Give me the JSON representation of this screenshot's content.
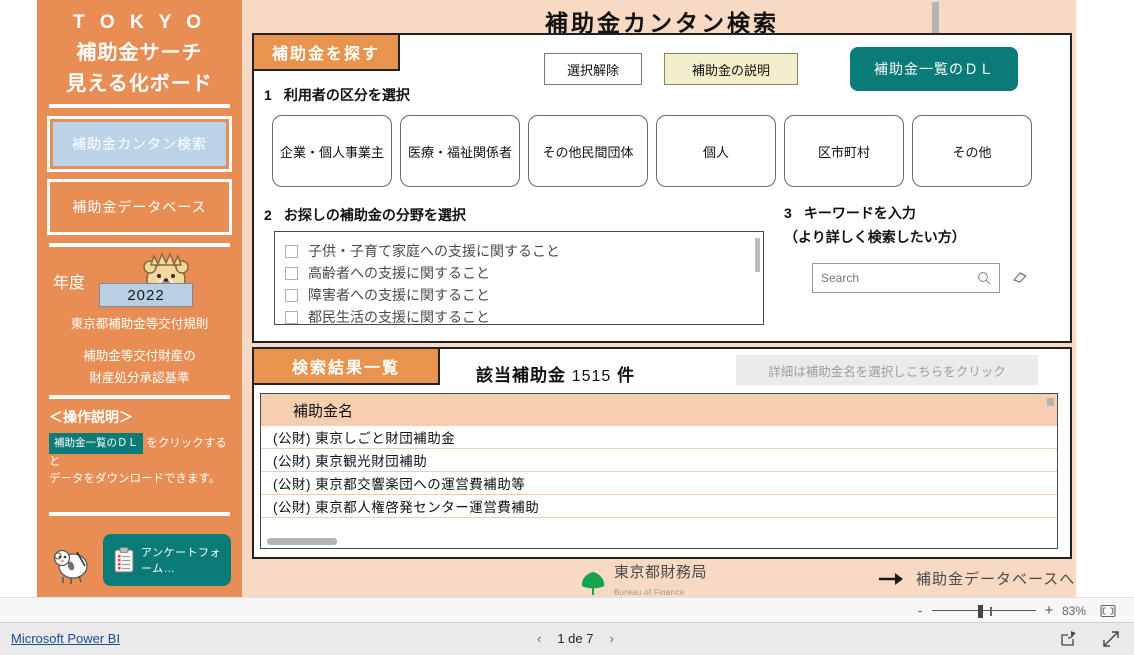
{
  "sidebar": {
    "brand_line1": "T O K Y O",
    "brand_line2": "補助金サーチ",
    "brand_line3": "見える化ボード",
    "nav": [
      {
        "label": "補助金カンタン検索",
        "state": "active"
      },
      {
        "label": "補助金データベース",
        "state": "inactive"
      }
    ],
    "year_label": "年度",
    "year_value": "2022",
    "links": [
      "東京都補助金等交付規則",
      "補助金等交付財産の",
      "財産処分承認基準"
    ],
    "ops_title": "＜操作説明＞",
    "ops_chip": "補助金一覧のＤＬ",
    "ops_text_1": "をクリックすると",
    "ops_text_2": "データをダウンロードできます。",
    "survey_button": "アンケートフォーム…",
    "colors": {
      "sidebar_bg": "#e88e54",
      "active_nav": "#bcd4e8",
      "teal": "#0b7b77",
      "year_pill": "#b9cfe3"
    }
  },
  "page": {
    "title": "補助金カンタン検索",
    "canvas_bg": "#f7d9c4"
  },
  "search_panel": {
    "tab_label": "補助金を探す",
    "buttons": {
      "clear": "選択解除",
      "explain": "補助金の説明",
      "download": "補助金一覧のＤＬ"
    },
    "step1": {
      "num": "1",
      "label": "利用者の区分を選択"
    },
    "categories": [
      "企業・個人事業主",
      "医療・福祉関係者",
      "その他民間団体",
      "個人",
      "区市町村",
      "その他"
    ],
    "step2": {
      "num": "2",
      "label": "お探しの補助金の分野を選択"
    },
    "fields": [
      "子供・子育て家庭への支援に関すること",
      "高齢者への支援に関すること",
      "障害者への支援に関すること",
      "都民生活の支援に関すること"
    ],
    "step3": {
      "num": "3",
      "label": "キーワードを入力",
      "sub": "（より詳しく検索したい方）"
    },
    "search_placeholder": "Search",
    "search_value": ""
  },
  "results_panel": {
    "tab_label": "検索結果一覧",
    "count_prefix": "該当補助金",
    "count_value": "1515",
    "count_suffix": "件",
    "detail_hint": "詳細は補助金名を選択しこちらをクリック",
    "column_header": "補助金名",
    "rows": [
      "(公財) 東京しごと財団補助金",
      "(公財) 東京観光財団補助",
      "(公財) 東京都交響楽団への運営費補助等",
      "(公財) 東京都人権啓発センター運営費補助"
    ]
  },
  "footer": {
    "logo_name": "東京都財務局",
    "logo_sub": "Bureau of Finance",
    "link_text": "補助金データベースへ"
  },
  "zoombar": {
    "minus": "-",
    "plus": "+",
    "percent": "83%"
  },
  "pbibar": {
    "brand": "Microsoft Power BI",
    "prev": "‹",
    "next": "›",
    "pager": "1 de 7"
  }
}
